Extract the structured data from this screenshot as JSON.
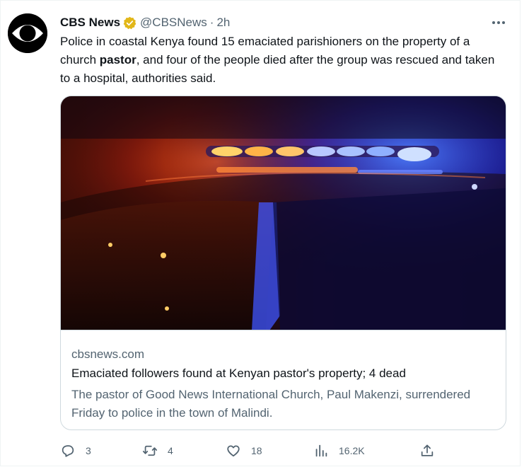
{
  "tweet": {
    "author_name": "CBS News",
    "handle": "@CBSNews",
    "separator": "·",
    "time": "2h",
    "text_before": "Police in coastal Kenya found 15 emaciated parishioners on the property of a church ",
    "text_bold": "pastor",
    "text_after": ", and four of the people died after the group was rescued and taken to a hospital, authorities said."
  },
  "card": {
    "domain": "cbsnews.com",
    "title": "Emaciated followers found at Kenyan pastor's property; 4 dead",
    "description": "The pastor of Good News International Church, Paul Makenzi, surrendered Friday to police in the town of Malindi."
  },
  "actions": {
    "reply_count": "3",
    "retweet_count": "4",
    "like_count": "18",
    "views_count": "16.2K"
  },
  "icons": {
    "avatar": "cbs-eye-logo",
    "verified": "verified-badge-icon",
    "more": "more-icon",
    "reply": "reply-icon",
    "retweet": "retweet-icon",
    "like": "heart-icon",
    "views": "views-icon",
    "share": "share-icon"
  },
  "colors": {
    "text": "#0f1419",
    "secondary": "#536471",
    "border": "#cfd9de",
    "verified_gold": "#e2b719"
  }
}
